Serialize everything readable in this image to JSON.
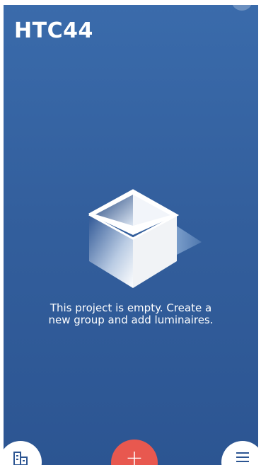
{
  "project": {
    "title": "HTC44"
  },
  "empty_state": {
    "icon": "empty-box-icon",
    "line1": "This project is empty. Create a",
    "line2": "new group and add luminaires."
  },
  "bottom_bar": {
    "left_icon": "building-icon",
    "center_icon": "plus-icon",
    "center_label": "+",
    "right_icon": "menu-icon"
  },
  "colors": {
    "background_top": "#3a6bab",
    "background_bottom": "#2c5592",
    "accent": "#e8584f"
  }
}
